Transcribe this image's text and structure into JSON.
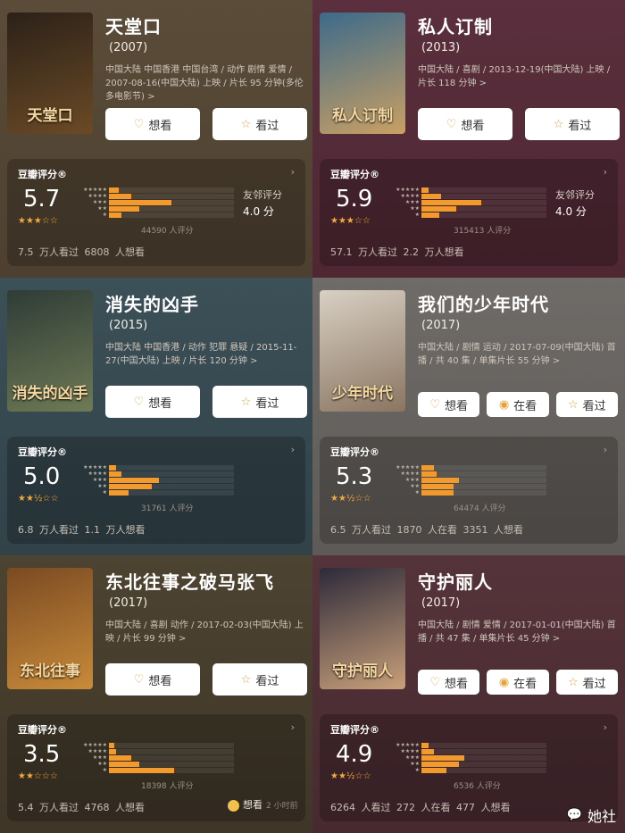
{
  "panels": [
    {
      "title": "天堂口",
      "year": "(2007)",
      "info": "中国大陆 中国香港 中国台湾 / 动作 剧情 爱情 / 2007-08-16(中国大陆) 上映 / 片长 95 分钟(多伦多电影节) >",
      "poster_text": "天堂口",
      "buttons": [
        {
          "label": "想看",
          "icon": "heart-icon"
        },
        {
          "label": "看过",
          "icon": "star-icon"
        }
      ],
      "rating_label": "豆瓣评分®",
      "score": "5.7",
      "stars": "★★★☆☆",
      "dist": [
        8,
        18,
        50,
        24,
        10
      ],
      "count": "44590 人评分",
      "friend_label": "友邻评分",
      "friend_score": "4.0 分",
      "foot": [
        "7.5 万人看过",
        "6808 人想看"
      ]
    },
    {
      "title": "私人订制",
      "year": "(2013)",
      "info": "中国大陆 / 喜剧 / 2013-12-19(中国大陆) 上映 / 片长 118 分钟 >",
      "poster_text": "私人订制",
      "buttons": [
        {
          "label": "想看",
          "icon": "heart-icon"
        },
        {
          "label": "看过",
          "icon": "star-icon"
        }
      ],
      "rating_label": "豆瓣评分®",
      "score": "5.9",
      "stars": "★★★☆☆",
      "dist": [
        6,
        16,
        48,
        28,
        14
      ],
      "count": "315413 人评分",
      "friend_label": "友邻评分",
      "friend_score": "4.0 分",
      "foot": [
        "57.1 万人看过",
        "2.2 万人想看"
      ]
    },
    {
      "title": "消失的凶手",
      "year": "(2015)",
      "info": "中国大陆 中国香港 / 动作 犯罪 悬疑 / 2015-11-27(中国大陆) 上映 / 片长 120 分钟 >",
      "poster_text": "消失的凶手",
      "buttons": [
        {
          "label": "想看",
          "icon": "heart-icon"
        },
        {
          "label": "看过",
          "icon": "star-icon"
        }
      ],
      "rating_label": "豆瓣评分®",
      "score": "5.0",
      "stars": "★★½☆☆",
      "dist": [
        6,
        10,
        40,
        34,
        16
      ],
      "count": "31761 人评分",
      "friend_label": "",
      "friend_score": "",
      "foot": [
        "6.8 万人看过",
        "1.1 万人想看"
      ]
    },
    {
      "title": "我们的少年时代",
      "year": "(2017)",
      "info": "中国大陆 / 剧情 运动 / 2017-07-09(中国大陆) 首播 / 共 40 集 / 单集片长 55 分钟 >",
      "poster_text": "少年时代",
      "buttons": [
        {
          "label": "想看",
          "icon": "heart-icon"
        },
        {
          "label": "在看",
          "icon": "circle-icon"
        },
        {
          "label": "看过",
          "icon": "star-icon"
        }
      ],
      "rating_label": "豆瓣评分®",
      "score": "5.3",
      "stars": "★★½☆☆",
      "dist": [
        10,
        12,
        30,
        26,
        26
      ],
      "count": "64474 人评分",
      "friend_label": "",
      "friend_score": "",
      "foot": [
        "6.5 万人看过",
        "1870 人在看",
        "3351 人想看"
      ]
    },
    {
      "title": "东北往事之破马张飞",
      "year": "(2017)",
      "info": "中国大陆 / 喜剧 动作 / 2017-02-03(中国大陆) 上映 / 片长 99 分钟 >",
      "poster_text": "东北往事",
      "buttons": [
        {
          "label": "想看",
          "icon": "heart-icon"
        },
        {
          "label": "看过",
          "icon": "star-icon"
        }
      ],
      "rating_label": "豆瓣评分®",
      "score": "3.5",
      "stars": "★★☆☆☆",
      "dist": [
        4,
        6,
        18,
        24,
        52
      ],
      "count": "18398 人评分",
      "friend_label": "",
      "friend_score": "",
      "foot": [
        "5.4 万人看过",
        "4768 人想看"
      ],
      "extra": {
        "label": "想看",
        "time": "2 小时前"
      }
    },
    {
      "title": "守护丽人",
      "year": "(2017)",
      "info": "中国大陆 / 剧情 爱情 / 2017-01-01(中国大陆) 首播 / 共 47 集 / 单集片长 45 分钟 >",
      "poster_text": "守护丽人",
      "buttons": [
        {
          "label": "想看",
          "icon": "heart-icon"
        },
        {
          "label": "在看",
          "icon": "circle-icon"
        },
        {
          "label": "看过",
          "icon": "star-icon"
        }
      ],
      "rating_label": "豆瓣评分®",
      "score": "4.9",
      "stars": "★★½☆☆",
      "dist": [
        6,
        10,
        34,
        30,
        20
      ],
      "count": "6536 人评分",
      "friend_label": "",
      "friend_score": "",
      "foot": [
        "6264 人看过",
        "272 人在看",
        "477 人想看"
      ]
    }
  ],
  "watermark": "她社"
}
